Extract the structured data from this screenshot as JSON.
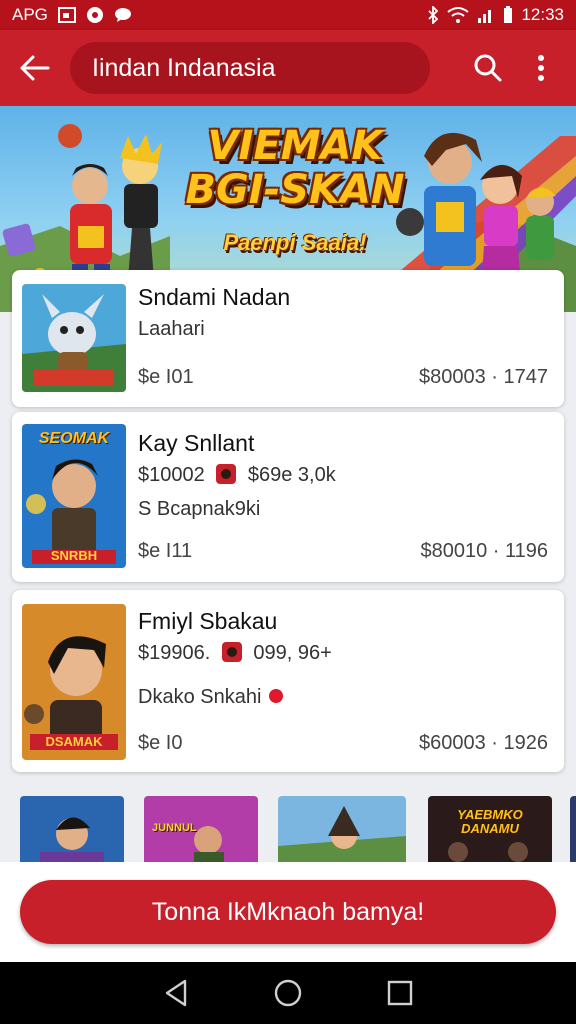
{
  "status_bar": {
    "carrier": "APG",
    "time": "12:33",
    "icons": [
      "image-icon",
      "record-icon",
      "chat-bubble-icon",
      "bluetooth-icon",
      "wifi-icon",
      "signal-icon",
      "battery-icon"
    ]
  },
  "app_bar": {
    "back_icon": "back-arrow-icon",
    "search_text": "Iindan Indanasia",
    "actions": [
      "search-icon",
      "more-vert-icon"
    ]
  },
  "hero": {
    "title_line1": "VIEMAK",
    "title_line2": "BGI-SKAN",
    "subtitle": "Paenpi Saaia!"
  },
  "cards": [
    {
      "title": "Sndami Nadan",
      "subtitle": "Laahari",
      "price_left": "$e I01",
      "price_right": "$80003 · 1747"
    },
    {
      "title": "Kay Snllant",
      "meta_left": "$10002",
      "meta_right": "$69e 3,0k",
      "subtitle": "S Bcapnak9ki",
      "price_left": "$e I11",
      "price_right": "$80010 · 1196",
      "thumb_text_top": "SEOMAK",
      "thumb_text_bottom": "SNRBH"
    },
    {
      "title": "Fmiyl Sbakau",
      "meta_left": "$19906.",
      "meta_right": "099, 96+",
      "subtitle": "Dkako Snkahi",
      "price_left": "$e I0",
      "price_right": "$60003 · 1926",
      "thumb_text_bottom": "DSAMAK"
    }
  ],
  "strip": {
    "tile_texts": [
      "",
      "JUNNUL",
      "",
      "YAEBMKO DANAMU"
    ]
  },
  "cta": {
    "label": "Tonna IkMknaoh bamya!"
  },
  "nav": {
    "icons": [
      "nav-back-icon",
      "nav-home-icon",
      "nav-recents-icon"
    ]
  },
  "colors": {
    "primary": "#c8202b",
    "primary_dark": "#b5121b",
    "search_bg": "#a8141d",
    "card_bg": "#ffffff",
    "page_bg": "#eceef1"
  }
}
